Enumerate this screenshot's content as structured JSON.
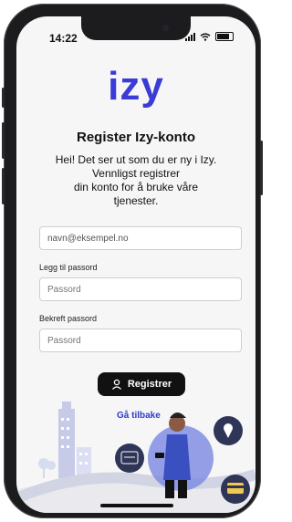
{
  "status": {
    "time": "14:22"
  },
  "brand": {
    "logo": "izy",
    "color": "#3b3bd6"
  },
  "page": {
    "title": "Register Izy-konto",
    "intro_lines": [
      "Hei! Det ser ut som du er ny i Izy.",
      "Vennligst registrer",
      "din konto for å bruke våre",
      "tjenester."
    ]
  },
  "form": {
    "email_value": "navn@eksempel.no",
    "password_label": "Legg til passord",
    "password_placeholder": "Passord",
    "confirm_label": "Bekreft passord",
    "confirm_placeholder": "Passord"
  },
  "actions": {
    "register_label": "Registrer",
    "back_label": "Gå tilbake"
  },
  "colors": {
    "accent": "#3b3bd6",
    "button": "#111111"
  },
  "icons": [
    "user-icon",
    "wifi-icon",
    "signal-icon",
    "battery-icon",
    "location-icon",
    "card-icon"
  ]
}
